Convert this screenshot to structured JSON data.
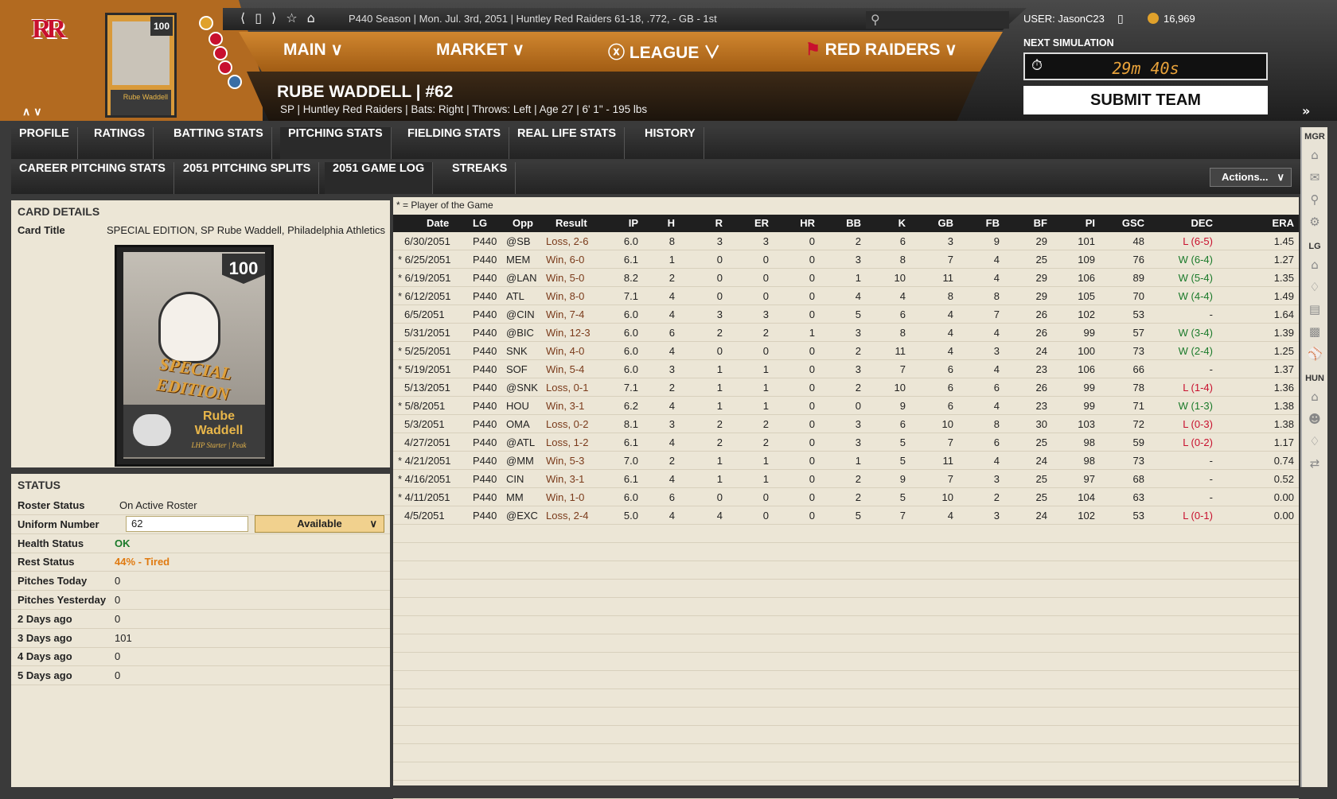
{
  "header": {
    "season_text": "P440 Season  |  Mon. Jul. 3rd, 2051  |  Huntley Red Raiders   61-18, .772, - GB - 1st",
    "user": "USER: JasonC23",
    "coins": "16,969",
    "mini_card_rating": "100",
    "mini_card_name": "Rube Waddell",
    "logo_text": "RR",
    "nav": [
      "MAIN",
      "MARKET",
      "LEAGUE",
      "RED RAIDERS"
    ],
    "player_name": "RUBE WADDELL  |  #62",
    "player_info": "SP | Huntley Red Raiders  |  Bats: Right  |  Throws: Left  |  Age 27  |  6' 1\" - 195 lbs",
    "next_sim_label": "NEXT SIMULATION",
    "timer": "29m 40s",
    "submit": "SUBMIT TEAM"
  },
  "tabs_primary": [
    "PROFILE",
    "RATINGS",
    "BATTING STATS",
    "PITCHING STATS",
    "FIELDING STATS",
    "REAL LIFE STATS",
    "HISTORY"
  ],
  "tabs_secondary": [
    "CAREER PITCHING STATS",
    "2051 PITCHING SPLITS",
    "2051 GAME LOG",
    "STREAKS"
  ],
  "actions_label": "Actions...",
  "sidebar": {
    "mgr": "MGR",
    "lg": "LG",
    "hun": "HUN"
  },
  "card_details": {
    "title": "CARD DETAILS",
    "card_title_label": "Card Title",
    "card_title_value": "SPECIAL EDITION, SP Rube Waddell, Philadelphia Athletics",
    "rating": "100",
    "edition_text": "SPECIAL EDITION",
    "card_name": "Rube Waddell",
    "card_sub": "LHP Starter | Peak"
  },
  "status": {
    "title": "STATUS",
    "rows": [
      {
        "label": "Roster Status",
        "value": "On Active Roster"
      },
      {
        "label": "Uniform Number",
        "value": ""
      },
      {
        "label": "Health Status",
        "value": "OK"
      },
      {
        "label": "Rest Status",
        "value": "44% - Tired"
      },
      {
        "label": "Pitches Today",
        "value": "0"
      },
      {
        "label": "Pitches Yesterday",
        "value": "0"
      },
      {
        "label": "2 Days ago",
        "value": "0"
      },
      {
        "label": "3 Days ago",
        "value": "101"
      },
      {
        "label": "4 Days ago",
        "value": "0"
      },
      {
        "label": "5 Days ago",
        "value": "0"
      }
    ],
    "uniform_number": "62",
    "availability": "Available"
  },
  "colors": {
    "health_ok": "#1a7a2a",
    "rest_tired": "#e07a10",
    "loss": "#c8102e",
    "win": "#1a7a2a",
    "accent": "#b26a20"
  },
  "game_log": {
    "note": "* = Player of the Game",
    "columns": [
      "Date",
      "LG",
      "Opp",
      "Result",
      "IP",
      "H",
      "R",
      "ER",
      "HR",
      "BB",
      "K",
      "GB",
      "FB",
      "BF",
      "PI",
      "GSC",
      "DEC",
      "ERA"
    ],
    "rows": [
      [
        "6/30/2051",
        "P440",
        "@SB",
        "Loss, 2-6",
        "6.0",
        "8",
        "3",
        "3",
        "0",
        "2",
        "6",
        "3",
        "9",
        "29",
        "101",
        "48",
        "L (6-5)",
        "1.45"
      ],
      [
        "* 6/25/2051",
        "P440",
        "MEM",
        "Win, 6-0",
        "6.1",
        "1",
        "0",
        "0",
        "0",
        "3",
        "8",
        "7",
        "4",
        "25",
        "109",
        "76",
        "W (6-4)",
        "1.27"
      ],
      [
        "* 6/19/2051",
        "P440",
        "@LAN",
        "Win, 5-0",
        "8.2",
        "2",
        "0",
        "0",
        "0",
        "1",
        "10",
        "11",
        "4",
        "29",
        "106",
        "89",
        "W (5-4)",
        "1.35"
      ],
      [
        "* 6/12/2051",
        "P440",
        "ATL",
        "Win, 8-0",
        "7.1",
        "4",
        "0",
        "0",
        "0",
        "4",
        "4",
        "8",
        "8",
        "29",
        "105",
        "70",
        "W (4-4)",
        "1.49"
      ],
      [
        "6/5/2051",
        "P440",
        "@CIN",
        "Win, 7-4",
        "6.0",
        "4",
        "3",
        "3",
        "0",
        "5",
        "6",
        "4",
        "7",
        "26",
        "102",
        "53",
        "-",
        "1.64"
      ],
      [
        "5/31/2051",
        "P440",
        "@BIC",
        "Win, 12-3",
        "6.0",
        "6",
        "2",
        "2",
        "1",
        "3",
        "8",
        "4",
        "4",
        "26",
        "99",
        "57",
        "W (3-4)",
        "1.39"
      ],
      [
        "* 5/25/2051",
        "P440",
        "SNK",
        "Win, 4-0",
        "6.0",
        "4",
        "0",
        "0",
        "0",
        "2",
        "11",
        "4",
        "3",
        "24",
        "100",
        "73",
        "W (2-4)",
        "1.25"
      ],
      [
        "* 5/19/2051",
        "P440",
        "SOF",
        "Win, 5-4",
        "6.0",
        "3",
        "1",
        "1",
        "0",
        "3",
        "7",
        "6",
        "4",
        "23",
        "106",
        "66",
        "-",
        "1.37"
      ],
      [
        "5/13/2051",
        "P440",
        "@SNK",
        "Loss, 0-1",
        "7.1",
        "2",
        "1",
        "1",
        "0",
        "2",
        "10",
        "6",
        "6",
        "26",
        "99",
        "78",
        "L (1-4)",
        "1.36"
      ],
      [
        "* 5/8/2051",
        "P440",
        "HOU",
        "Win, 3-1",
        "6.2",
        "4",
        "1",
        "1",
        "0",
        "0",
        "9",
        "6",
        "4",
        "23",
        "99",
        "71",
        "W (1-3)",
        "1.38"
      ],
      [
        "5/3/2051",
        "P440",
        "OMA",
        "Loss, 0-2",
        "8.1",
        "3",
        "2",
        "2",
        "0",
        "3",
        "6",
        "10",
        "8",
        "30",
        "103",
        "72",
        "L (0-3)",
        "1.38"
      ],
      [
        "4/27/2051",
        "P440",
        "@ATL",
        "Loss, 1-2",
        "6.1",
        "4",
        "2",
        "2",
        "0",
        "3",
        "5",
        "7",
        "6",
        "25",
        "98",
        "59",
        "L (0-2)",
        "1.17"
      ],
      [
        "* 4/21/2051",
        "P440",
        "@MM",
        "Win, 5-3",
        "7.0",
        "2",
        "1",
        "1",
        "0",
        "1",
        "5",
        "11",
        "4",
        "24",
        "98",
        "73",
        "-",
        "0.74"
      ],
      [
        "* 4/16/2051",
        "P440",
        "CIN",
        "Win, 3-1",
        "6.1",
        "4",
        "1",
        "1",
        "0",
        "2",
        "9",
        "7",
        "3",
        "25",
        "97",
        "68",
        "-",
        "0.52"
      ],
      [
        "* 4/11/2051",
        "P440",
        "MM",
        "Win, 1-0",
        "6.0",
        "6",
        "0",
        "0",
        "0",
        "2",
        "5",
        "10",
        "2",
        "25",
        "104",
        "63",
        "-",
        "0.00"
      ],
      [
        "4/5/2051",
        "P440",
        "@EXC",
        "Loss, 2-4",
        "5.0",
        "4",
        "4",
        "0",
        "0",
        "5",
        "7",
        "4",
        "3",
        "24",
        "102",
        "53",
        "L (0-1)",
        "0.00"
      ]
    ]
  }
}
